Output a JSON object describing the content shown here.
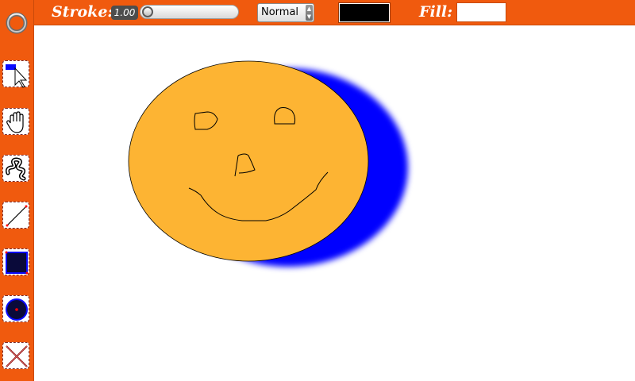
{
  "toolbar": {
    "stroke_label": "Stroke:",
    "stroke_width_value": "1.00",
    "stroke_slider_level": 0.0,
    "blend_mode": "Normal",
    "stroke_color": "#000000",
    "fill_label": "Fill:",
    "fill_color": "#ffffff"
  },
  "tools": [
    {
      "name": "select",
      "icon": "select-pointer-icon",
      "selected": false
    },
    {
      "name": "pan",
      "icon": "hand-icon",
      "selected": false
    },
    {
      "name": "freehand",
      "icon": "freehand-path-icon",
      "selected": false
    },
    {
      "name": "line",
      "icon": "line-icon",
      "selected": false
    },
    {
      "name": "rectangle",
      "icon": "rectangle-icon",
      "selected": false
    },
    {
      "name": "ellipse",
      "icon": "ellipse-icon",
      "selected": false
    },
    {
      "name": "delete",
      "icon": "delete-x-icon",
      "selected": false
    }
  ],
  "colors": {
    "chrome": "#f05a0e",
    "face_fill": "#fdb433",
    "face_outline": "#000000",
    "shadow": "#0000ff"
  },
  "drawing": {
    "shapes": [
      "ellipse",
      "left-eye",
      "right-eye",
      "nose",
      "smile"
    ]
  }
}
